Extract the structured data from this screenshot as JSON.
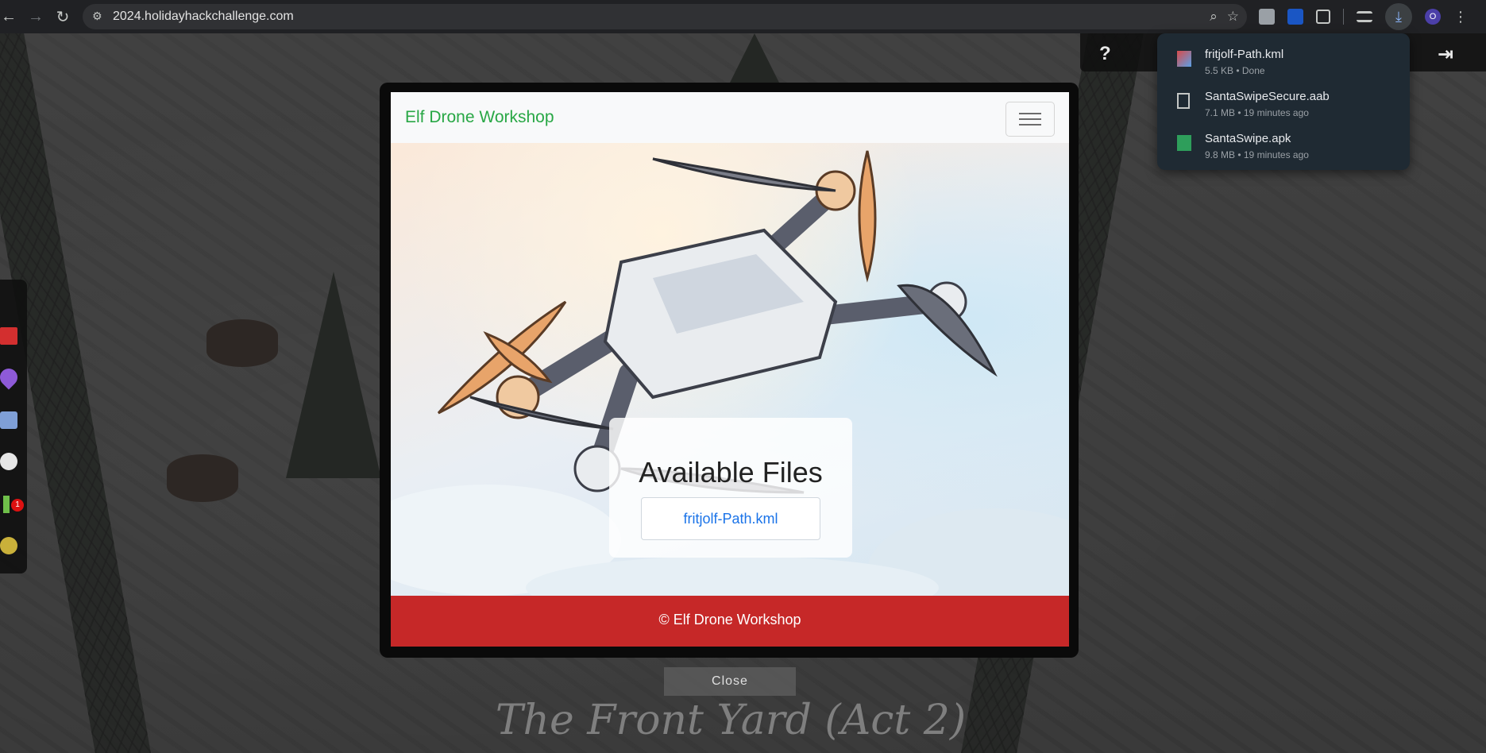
{
  "browser": {
    "url": "2024.holidayhackchallenge.com",
    "profile_initial": "O"
  },
  "downloads": [
    {
      "name": "fritjolf-Path.kml",
      "meta": "5.5 KB • Done",
      "icon": "kml-file-icon"
    },
    {
      "name": "SantaSwipeSecure.aab",
      "meta": "7.1 MB • 19 minutes ago",
      "icon": "file-icon"
    },
    {
      "name": "SantaSwipe.apk",
      "meta": "9.8 MB • 19 minutes ago",
      "icon": "apk-file-icon"
    }
  ],
  "game": {
    "area_title": "The Front Yard (Act 2)",
    "achievement_badge_count": "1",
    "side_dock_icons": [
      "book-icon",
      "map-pin-icon",
      "checklist-icon",
      "chat-icon",
      "info-icon",
      "badge-icon"
    ],
    "hud_icons": [
      "help-icon",
      "home-icon",
      "logout-icon"
    ]
  },
  "modal": {
    "brand": "Elf Drone Workshop",
    "files_title": "Available Files",
    "files": [
      "fritjolf-Path.kml"
    ],
    "footer": "© Elf Drone Workshop",
    "close_label": "Close"
  },
  "colors": {
    "brand_green": "#28a745",
    "footer_red": "#c62828",
    "link_blue": "#1a73e8"
  }
}
